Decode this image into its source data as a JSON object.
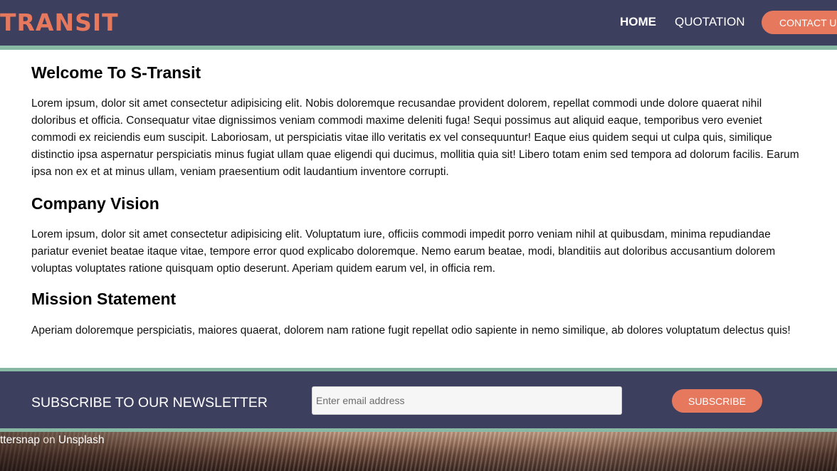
{
  "header": {
    "logo": "TRANSIT",
    "nav": {
      "home": "HOME",
      "quotation": "QUOTATION",
      "contact": "CONTACT US"
    }
  },
  "main": {
    "welcome_title": "Welcome To S-Transit",
    "welcome_text": "Lorem ipsum, dolor sit amet consectetur adipisicing elit. Nobis doloremque recusandae provident dolorem, repellat commodi unde dolore quaerat nihil doloribus et officia. Consequatur vitae dignissimos veniam commodi maxime deleniti fuga! Sequi possimus aut aliquid eaque, temporibus vero eveniet commodi ex reiciendis eum suscipit. Laboriosam, ut perspiciatis vitae illo veritatis ex vel consequuntur! Eaque eius quidem sequi ut culpa quis, similique distinctio ipsa aspernatur perspiciatis minus fugiat ullam quae eligendi qui ducimus, mollitia quia sit! Libero totam enim sed tempora ad dolorum facilis. Earum ipsa non ex et at minus ullam, veniam praesentium odit laudantium inventore corrupti.",
    "vision_title": "Company Vision",
    "vision_text": "Lorem ipsum, dolor sit amet consectetur adipisicing elit. Voluptatum iure, officiis commodi impedit porro veniam nihil at quibusdam, minima repudiandae pariatur eveniet beatae itaque vitae, tempore error quod explicabo doloremque. Nemo earum beatae, modi, blanditiis aut doloribus accusantium dolorem voluptas voluptates ratione quisquam optio deserunt. Aperiam quidem earum vel, in officia rem.",
    "mission_title": "Mission Statement",
    "mission_text": "Aperiam doloremque perspiciatis, maiores quaerat, dolorem nam ratione fugit repellat odio sapiente in nemo similique, ab dolores voluptatum delectus quis!"
  },
  "newsletter": {
    "title": "SUBSCRIBE TO OUR NEWSLETTER",
    "email_placeholder": "Enter email address",
    "email_value": "",
    "button": "SUBSCRIBE"
  },
  "photo_credit": {
    "author": "ttersnap",
    "on": "on",
    "site": "Unsplash"
  },
  "colors": {
    "header_bg": "#3d3f5f",
    "accent": "#e6785d",
    "divider": "#86b8a4"
  }
}
